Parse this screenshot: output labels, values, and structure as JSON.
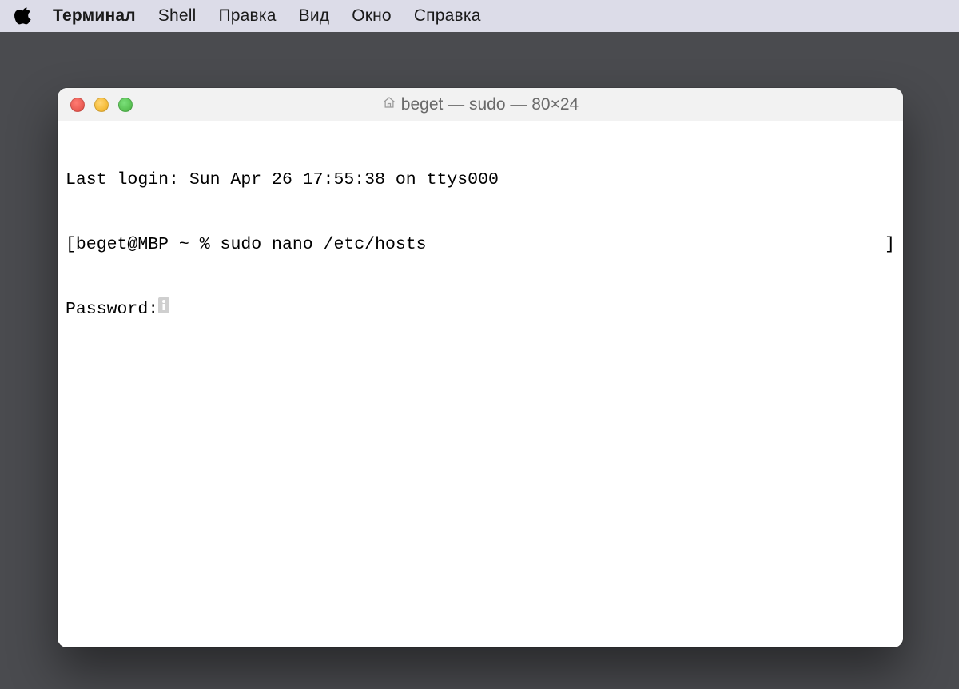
{
  "menubar": {
    "app_name": "Терминал",
    "items": [
      "Shell",
      "Правка",
      "Вид",
      "Окно",
      "Справка"
    ]
  },
  "window": {
    "title": "beget — sudo — 80×24"
  },
  "terminal": {
    "last_login": "Last login: Sun Apr 26 17:55:38 on ttys000",
    "prompt_left_bracket": "[",
    "prompt_user_host": "beget@MBP",
    "prompt_path": " ~ % ",
    "command": "sudo nano /etc/hosts",
    "prompt_right_bracket": "]",
    "password_label": "Password:"
  }
}
